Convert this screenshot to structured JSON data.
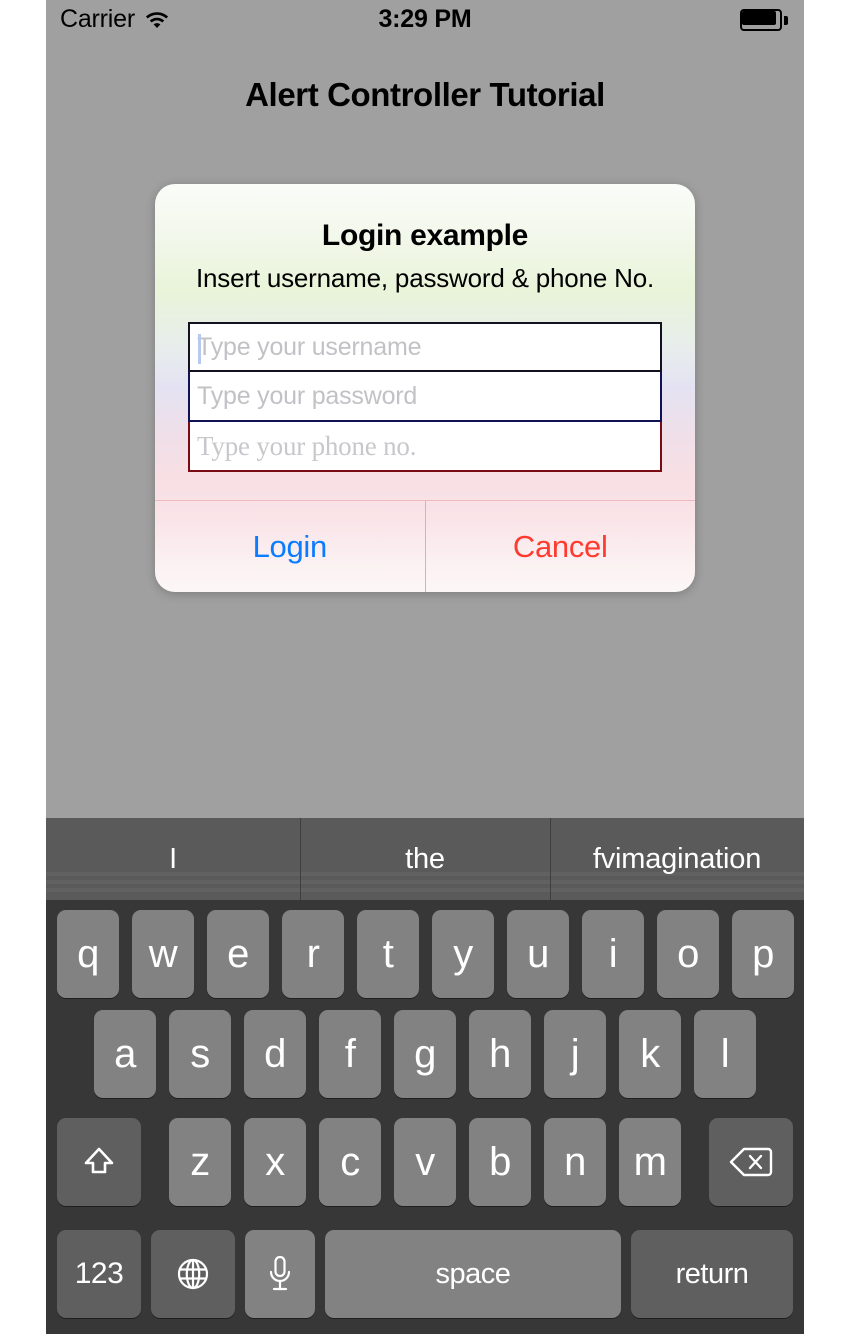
{
  "status_bar": {
    "carrier": "Carrier",
    "time": "3:29 PM",
    "wifi_icon": "wifi-icon",
    "battery_icon": "battery-full-icon"
  },
  "page": {
    "title": "Alert Controller Tutorial",
    "background_color": "#a0a0a0"
  },
  "alert": {
    "title": "Login example",
    "message": "Insert username, password & phone No.",
    "fields": [
      {
        "name": "username",
        "placeholder": "Type your username",
        "value": "",
        "focused": true,
        "border_color": "#111122",
        "font": "sans"
      },
      {
        "name": "password",
        "placeholder": "Type your password",
        "value": "",
        "focused": false,
        "border_color": "#111155",
        "font": "sans"
      },
      {
        "name": "phone",
        "placeholder": "Type your phone no.",
        "value": "",
        "focused": false,
        "border_color": "#7a0b12",
        "font": "serif"
      }
    ],
    "buttons": [
      {
        "label": "Login",
        "color": "#0a7cff"
      },
      {
        "label": "Cancel",
        "color": "#ff3b30"
      }
    ]
  },
  "keyboard": {
    "predictions": [
      "I",
      "the",
      "fvimagination"
    ],
    "row1": [
      "q",
      "w",
      "e",
      "r",
      "t",
      "y",
      "u",
      "i",
      "o",
      "p"
    ],
    "row2": [
      "a",
      "s",
      "d",
      "f",
      "g",
      "h",
      "j",
      "k",
      "l"
    ],
    "row3_letters": [
      "z",
      "x",
      "c",
      "v",
      "b",
      "n",
      "m"
    ],
    "shift_icon": "shift-arrow-icon",
    "delete_icon": "delete-backspace-icon",
    "numbers_key": "123",
    "globe_icon": "globe-icon",
    "mic_icon": "microphone-icon",
    "space_key": "space",
    "return_key": "return",
    "theme": "dark",
    "key_color": "#828282",
    "special_key_color": "#5f5f5f",
    "background_color": "#373737"
  }
}
